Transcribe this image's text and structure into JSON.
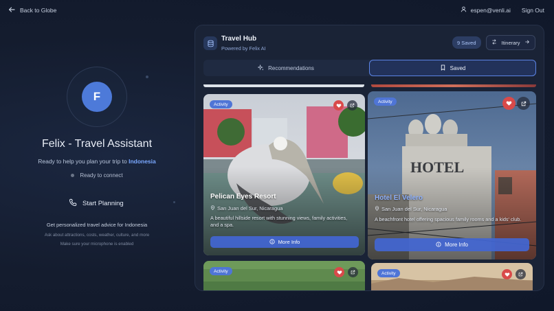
{
  "nav": {
    "back_label": "Back to Globe",
    "user_email": "espen@venli.ai",
    "signout_label": "Sign Out"
  },
  "assistant": {
    "avatar_letter": "F",
    "title": "Felix - Travel Assistant",
    "subtitle_prefix": "Ready to help you plan your trip to",
    "destination": "Indonesia",
    "status": "Ready to connect",
    "start_label": "Start Planning",
    "advice": "Get personalized travel advice for Indonesia",
    "hint_topics": "Ask about attractions, costs, weather, culture, and more",
    "hint_mic": "Make sure your microphone is enabled"
  },
  "hub": {
    "title": "Travel Hub",
    "subtitle": "Powered by Felix AI",
    "saved_count": "9 Saved",
    "itinerary_label": "Itinerary",
    "tabs": [
      {
        "label": "Recommendations",
        "active": false
      },
      {
        "label": "Saved",
        "active": true
      }
    ]
  },
  "cards": [
    {
      "badge": "Activity",
      "title": "Pelican Eyes Resort",
      "location": "San Juan del Sur, Nicaragua",
      "description": "A beautiful hillside resort with stunning views, family activities, and a spa.",
      "more_label": "More Info",
      "saved": true
    },
    {
      "badge": "Activity",
      "title": "Hotel El Velero",
      "location": "San Juan del Sur, Nicaragua",
      "description": "A beachfront hotel offering spacious family rooms and a kids' club.",
      "more_label": "More Info",
      "saved": true
    },
    {
      "badge": "Activity",
      "saved": true
    },
    {
      "badge": "Activity",
      "saved": true
    }
  ],
  "colors": {
    "accent": "#4f75d6",
    "heart": "#d94a4a",
    "destination": "#7aa8ff"
  }
}
